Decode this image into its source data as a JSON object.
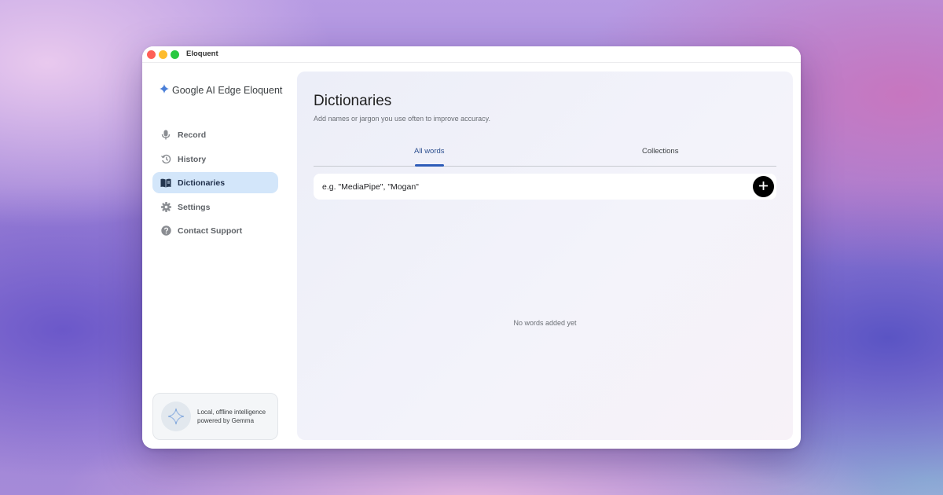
{
  "window": {
    "title": "Eloquent"
  },
  "sidebar": {
    "brand": "Google AI Edge Eloquent",
    "items": [
      {
        "label": "Record",
        "icon": "microphone-icon",
        "active": false
      },
      {
        "label": "History",
        "icon": "history-icon",
        "active": false
      },
      {
        "label": "Dictionaries",
        "icon": "book-icon",
        "active": true
      },
      {
        "label": "Settings",
        "icon": "gear-icon",
        "active": false
      },
      {
        "label": "Contact Support",
        "icon": "help-icon",
        "active": false
      }
    ],
    "promo": {
      "line1": "Local, offline intelligence",
      "line2": "powered by Gemma"
    }
  },
  "main": {
    "title": "Dictionaries",
    "subtitle": "Add names or jargon you use often to improve accuracy.",
    "tabs": [
      {
        "label": "All words",
        "active": true
      },
      {
        "label": "Collections",
        "active": false
      }
    ],
    "input": {
      "placeholder": "e.g. \"MediaPipe\", \"Mogan\"",
      "value": ""
    },
    "empty_state": "No words added yet"
  },
  "colors": {
    "active_bg": "#d3e6fa",
    "tab_active": "#2d5bb8",
    "add_button": "#000000"
  }
}
